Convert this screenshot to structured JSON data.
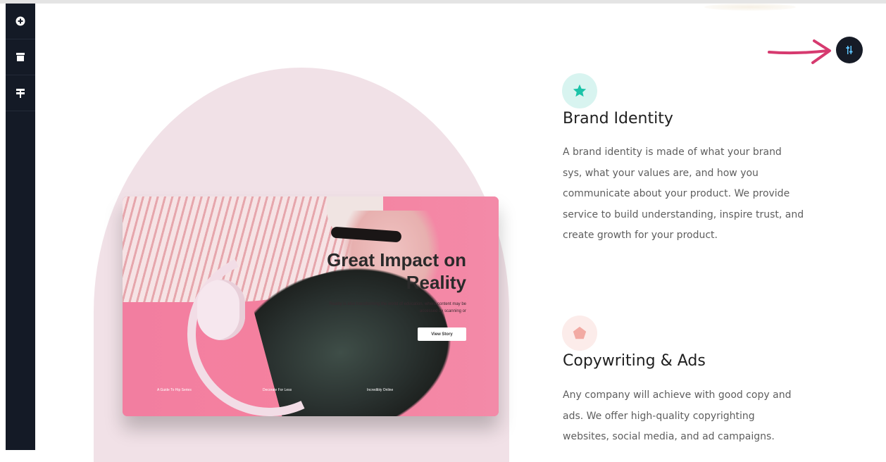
{
  "sidebar": {
    "items": [
      {
        "icon": "plus-circle-icon"
      },
      {
        "icon": "box-icon"
      },
      {
        "icon": "layout-icon"
      }
    ]
  },
  "hero_card": {
    "title_line1": "Great Impact on",
    "title_line2": "Reality",
    "description": "Reality is also transforming the world of education, where content may be accessed by scanning or",
    "button_label": "View Story",
    "links": [
      "A Guide To Hip Series",
      "Decorate For Less",
      "Incredibly Online"
    ]
  },
  "settings_button": {
    "icon": "sliders-icon"
  },
  "colors": {
    "accent_teal": "#1bc3a8",
    "accent_pink": "#f2aaa3",
    "annotation_arrow": "#d63a6f",
    "sidebar_bg": "#141a26"
  },
  "features": [
    {
      "icon": "star-icon",
      "title": "Brand Identity",
      "lines": [
        "A brand identity is made of what your brand",
        "sys, what your values are, and how you",
        "communicate about your product. We provide",
        "service to build understanding, inspire trust, and",
        "create growth for your product."
      ]
    },
    {
      "icon": "pentagon-icon",
      "title": "Copywriting & Ads",
      "lines": [
        "Any company will achieve with good copy and",
        "ads. We offer high-quality copyrighting",
        "websites, social media, and ad campaigns."
      ]
    }
  ]
}
